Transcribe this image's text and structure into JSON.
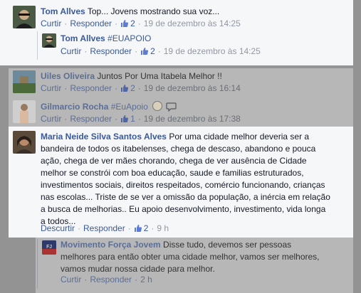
{
  "comments": [
    {
      "author": "Tom Allves",
      "body": "Top... Jovens mostrando sua voz...",
      "action_like": "Curtir",
      "action_reply": "Responder",
      "likes": "2",
      "time": "19 de dezembro às 14:25"
    },
    {
      "author": "Tom Allves",
      "hashtag": "#EUAPOIO",
      "action_like": "Curtir",
      "action_reply": "Responder",
      "likes": "2",
      "time": "19 de dezembro às 14:25"
    },
    {
      "author": "Uiles Oliveira",
      "body": "Juntos Por Uma Itabela Melhor !!",
      "action_like": "Curtir",
      "action_reply": "Responder",
      "likes": "2",
      "time": "19 de dezembro às 16:14"
    },
    {
      "author": "Gilmarcio Rocha",
      "hashtag": "#EuApoio",
      "action_like": "Curtir",
      "action_reply": "Responder",
      "likes": "1",
      "time": "19 de dezembro às 17:38"
    },
    {
      "author": "Maria Neide Silva Santos Alves",
      "body_lines": [
        "Por uma cidade melhor deveria ser a",
        "bandeira de todos os itabelenses, chega de descaso, abandono e pouca",
        "ação, chega de ver mães chorando, chega de ver ausência de Cidade",
        "melhor se constrói com boa educação, saude e familias estruturados,",
        "investimentos sociais, direitos respeitados, comércio funcionando, crianças",
        "nas escolas... Triste de se ver a omissão da população, a inércia em relação",
        "a busca de melhorias.. Eu apoio desenvolvimento, investimento, vida longa",
        "a todos..."
      ],
      "action_like": "Descurtir",
      "action_reply": "Responder",
      "likes": "2",
      "time": "9 h"
    },
    {
      "author": "Movimento Força Jovem",
      "body_lines": [
        "Disse tudo, devemos ser pessoas",
        "melhores para então obter uma cidade melhor, vamos ser melhores,",
        "vamos mudar nossa cidade para melhor."
      ],
      "action_like": "Curtir",
      "action_reply": "Responder",
      "time": "2 h"
    }
  ],
  "colors": {
    "link": "#3b5998",
    "meta": "#9197a3",
    "highlight_bg": "#f6f7f9",
    "dim_overlay": "#939393"
  },
  "icons": {
    "like": "thumbs-up-icon",
    "emoji": "smiley-icon",
    "chat": "chat-bubble-icon"
  }
}
